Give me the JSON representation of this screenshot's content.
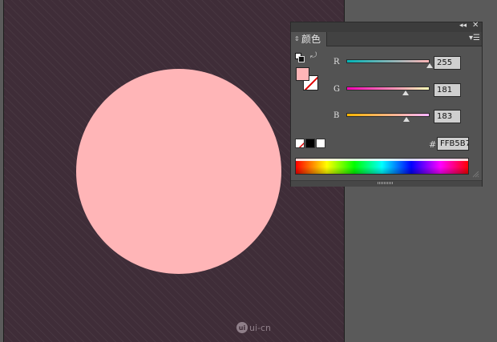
{
  "artwork": {
    "background_color": "#3f2d38",
    "circle_color": "#ffb5b7",
    "watermark_text": "ui-cn"
  },
  "panel": {
    "tab_label": "颜色",
    "channels": [
      {
        "label": "R",
        "value": "255",
        "level": 255,
        "gradient": [
          "#00b4b7",
          "#ffb5b7"
        ]
      },
      {
        "label": "G",
        "value": "181",
        "level": 181,
        "gradient": [
          "#ff00b7",
          "#ffffb7"
        ]
      },
      {
        "label": "B",
        "value": "183",
        "level": 183,
        "gradient": [
          "#ffb500",
          "#ffb5ff"
        ]
      }
    ],
    "hash": "#",
    "hex_value": "FFB5B7",
    "fill_color": "#ffb5b7"
  }
}
